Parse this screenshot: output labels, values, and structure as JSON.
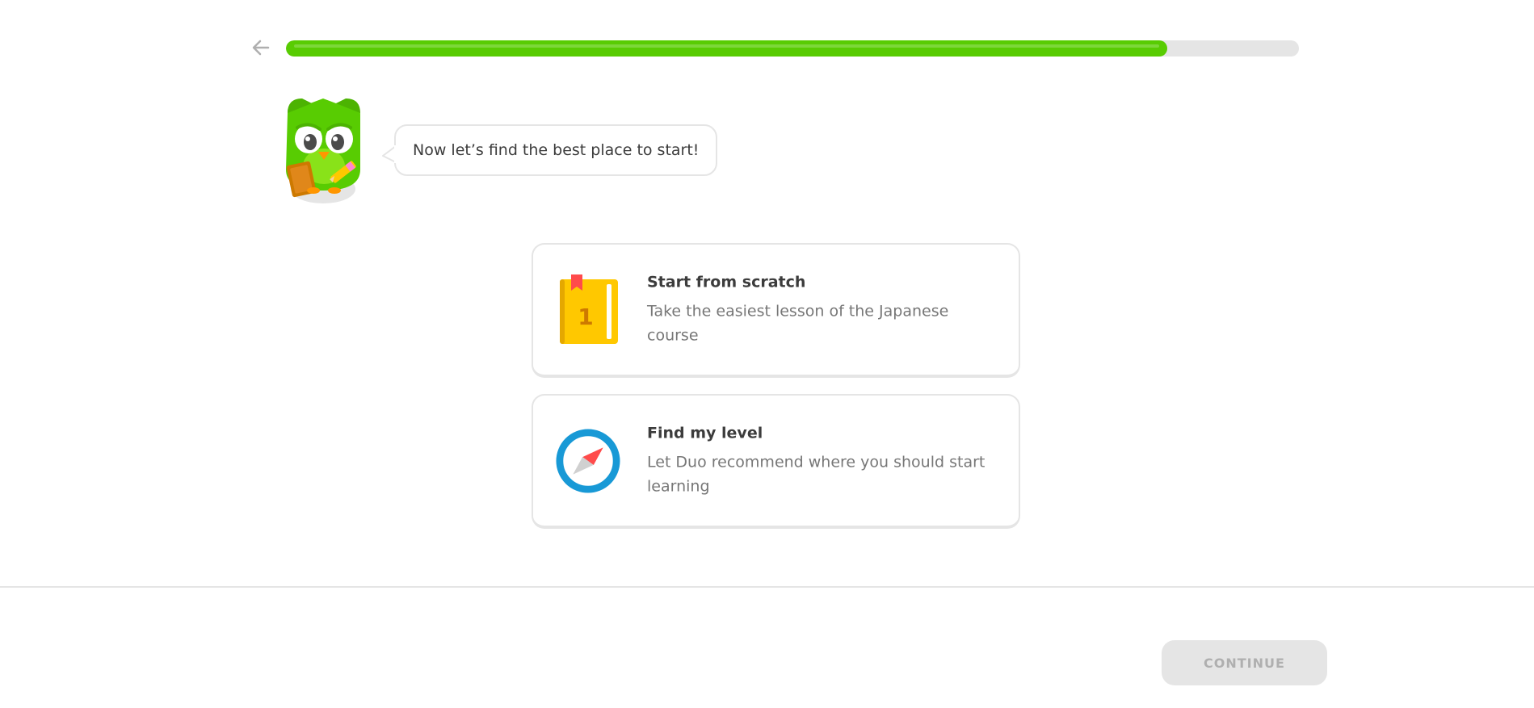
{
  "header": {
    "back_icon": "arrow-left-icon",
    "progress": {
      "fraction": 0.87,
      "color": "#58cc02",
      "track_color": "#e5e5e5"
    }
  },
  "mascot": {
    "icon": "duo-owl-mascot",
    "speech": "Now let’s find the best place to start!"
  },
  "options": [
    {
      "icon": "book-icon",
      "book_number": "1",
      "title": "Start from scratch",
      "description": "Take the easiest lesson of the Japanese course"
    },
    {
      "icon": "compass-icon",
      "title": "Find my level",
      "description": "Let Duo recommend where you should start learning"
    }
  ],
  "footer": {
    "continue_label": "CONTINUE"
  },
  "colors": {
    "accent_green": "#58cc02",
    "border": "#e5e5e5",
    "text_dark": "#3c3c3c",
    "text_muted": "#777777",
    "compass_blue": "#1899d6",
    "book_yellow": "#ffc800"
  }
}
